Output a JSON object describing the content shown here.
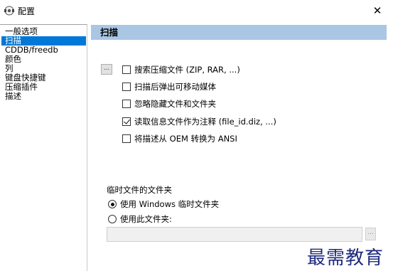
{
  "window": {
    "title": "配置",
    "close_glyph": "✕"
  },
  "sidebar": {
    "items": [
      {
        "label": "一般选项",
        "selected": false
      },
      {
        "label": "扫描",
        "selected": true
      },
      {
        "label": "CDDB/freedb",
        "selected": false
      },
      {
        "label": "颜色",
        "selected": false
      },
      {
        "label": "列",
        "selected": false
      },
      {
        "label": "键盘快捷键",
        "selected": false
      },
      {
        "label": "压缩插件",
        "selected": false
      },
      {
        "label": "描述",
        "selected": false
      }
    ]
  },
  "section": {
    "title": "扫描",
    "header_color": "#a9c6e3"
  },
  "browse_button": {
    "label": "..."
  },
  "options": [
    {
      "label": "搜索压缩文件 (ZIP, RAR, ...)",
      "checked": false
    },
    {
      "label": "扫描后弹出可移动媒体",
      "checked": false
    },
    {
      "label": "忽略隐藏文件和文件夹",
      "checked": false
    },
    {
      "label": "读取信息文件作为注释 (file_id.diz, ...)",
      "checked": true
    },
    {
      "label": "将描述从 OEM 转换为 ANSI",
      "checked": false
    }
  ],
  "temp_folder": {
    "group_label": "临时文件的文件夹",
    "radios": [
      {
        "label": "使用 Windows 临时文件夹",
        "checked": true
      },
      {
        "label": "使用此文件夹:",
        "checked": false
      }
    ],
    "path_value": "",
    "browse_label": "..."
  },
  "watermark": {
    "text": "最需教育"
  },
  "colors": {
    "selection": "#0078d7"
  }
}
